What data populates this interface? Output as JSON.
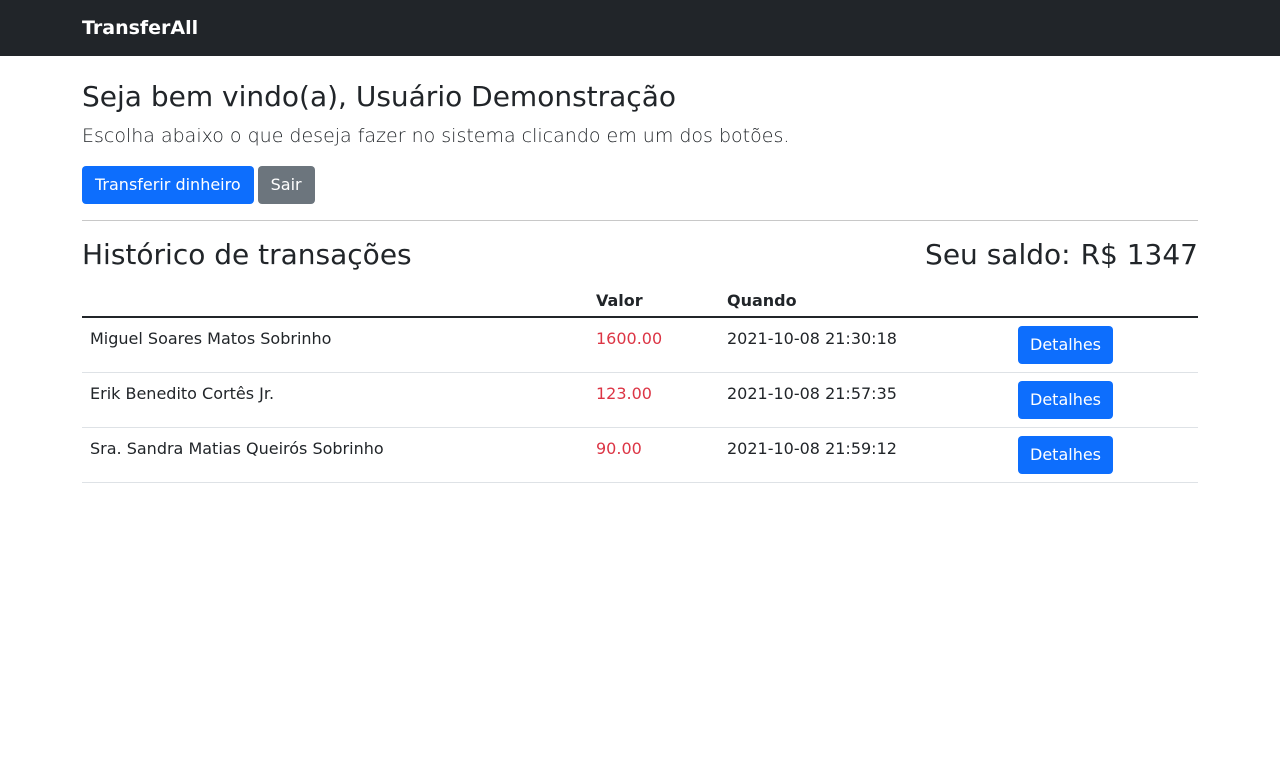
{
  "navbar": {
    "brand": "TransferAll"
  },
  "welcome": {
    "title": "Seja bem vindo(a), Usuário Demonstração",
    "subtitle": "Escolha abaixo o que deseja fazer no sistema clicando em um dos botões."
  },
  "actions": {
    "transfer_label": "Transferir dinheiro",
    "logout_label": "Sair"
  },
  "history": {
    "title": "Histórico de transações",
    "balance_label": "Seu saldo:",
    "balance_value": "R$ 1347"
  },
  "table": {
    "headers": {
      "name": "",
      "value": "Valor",
      "when": "Quando",
      "action": ""
    },
    "rows": [
      {
        "name": "Miguel Soares Matos Sobrinho",
        "value": "1600.00",
        "when": "2021-10-08 21:30:18",
        "action_label": "Detalhes"
      },
      {
        "name": "Erik Benedito Cortês Jr.",
        "value": "123.00",
        "when": "2021-10-08 21:57:35",
        "action_label": "Detalhes"
      },
      {
        "name": "Sra. Sandra Matias Queirós Sobrinho",
        "value": "90.00",
        "when": "2021-10-08 21:59:12",
        "action_label": "Detalhes"
      }
    ]
  },
  "colors": {
    "navbar_bg": "#212529",
    "primary": "#0d6efd",
    "secondary": "#6c757d",
    "negative_amount": "#dc3545"
  }
}
